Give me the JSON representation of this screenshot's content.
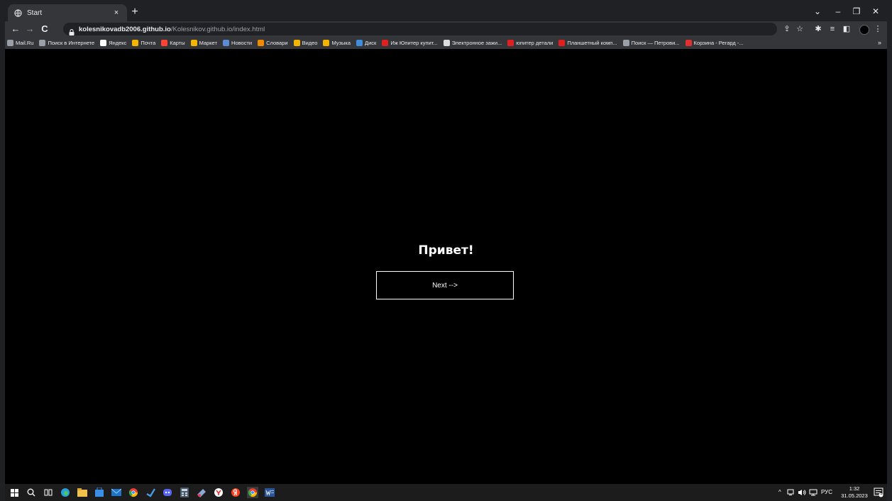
{
  "browser": {
    "tab": {
      "title": "Start",
      "close": "×"
    },
    "new_tab": "+",
    "window_controls": {
      "dropdown": "⌄",
      "minimize": "–",
      "maximize": "❐",
      "close": "✕"
    },
    "nav": {
      "back": "←",
      "forward": "→",
      "reload": "C"
    },
    "url": {
      "host": "kolesnikovadb2006.github.io",
      "path": "/Kolesnikov.github.io/index.html"
    },
    "toolbar_icons": {
      "share": "⇪",
      "star": "☆",
      "extensions": "✱",
      "reading_list": "≡",
      "side_panel": "◧",
      "menu": "⋮"
    }
  },
  "bookmarks": [
    {
      "label": "Mail.Ru",
      "color": "#9aa0a6"
    },
    {
      "label": "Поиск в Интернете",
      "color": "#9aa0a6"
    },
    {
      "label": "Яндекс",
      "color": "#ffffff"
    },
    {
      "label": "Почта",
      "color": "#f5b400"
    },
    {
      "label": "Карты",
      "color": "#ff4433"
    },
    {
      "label": "Маркет",
      "color": "#f5b400"
    },
    {
      "label": "Новости",
      "color": "#5b8dd6"
    },
    {
      "label": "Словари",
      "color": "#f08a00"
    },
    {
      "label": "Видео",
      "color": "#f5b400"
    },
    {
      "label": "Музыка",
      "color": "#f5b400"
    },
    {
      "label": "Диск",
      "color": "#3f8edc"
    },
    {
      "label": "Иж Юпитер купит...",
      "color": "#e02020"
    },
    {
      "label": "Электронное зажи...",
      "color": "#dddddd"
    },
    {
      "label": "юпитер детали",
      "color": "#e02020"
    },
    {
      "label": "Планшетный комп...",
      "color": "#e02020"
    },
    {
      "label": "Поиск — Петрови...",
      "color": "#9aa0a6"
    },
    {
      "label": "Корзина - Регард -...",
      "color": "#e03030"
    }
  ],
  "bookmarks_overflow": "»",
  "page": {
    "greeting": "Привет!",
    "next_label": "Next -->"
  },
  "taskbar": {
    "tray": {
      "chevron": "^",
      "language": "РУС"
    },
    "clock": {
      "time": "1:32",
      "date": "31.05.2023"
    },
    "notification_count": "3"
  }
}
